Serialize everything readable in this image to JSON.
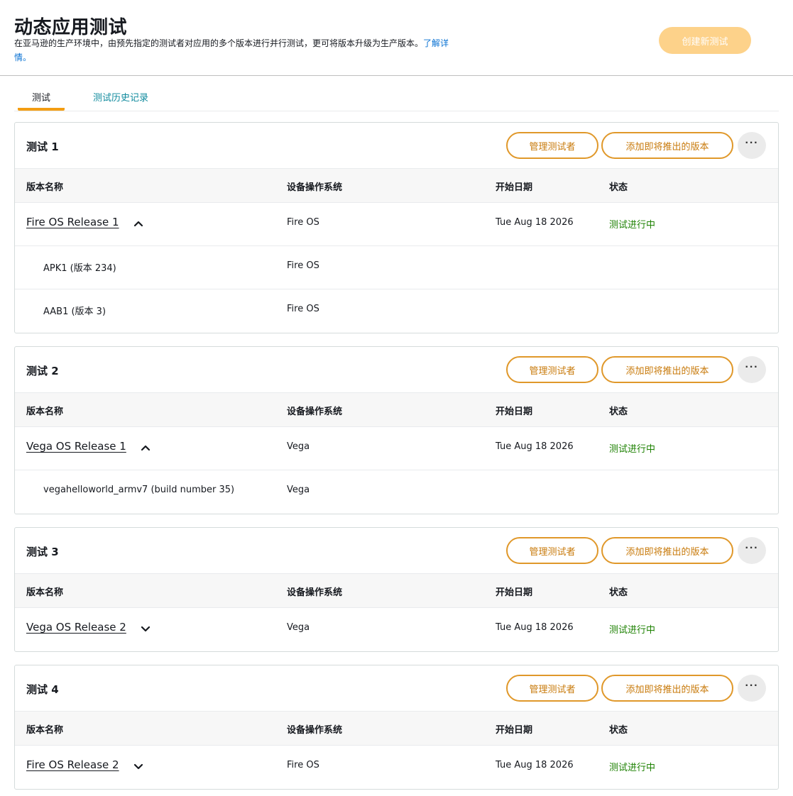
{
  "header": {
    "title": "动态应用测试",
    "description": "在亚马逊的生产环境中，由预先指定的测试者对应用的多个版本进行并行测试，更可将版本升级为生产版本。",
    "learn_more": "了解详情。",
    "create_button": "创建新测试"
  },
  "tabs": [
    {
      "label": "测试"
    },
    {
      "label": "测试历史记录"
    }
  ],
  "columns": {
    "name": "版本名称",
    "os": "设备操作系统",
    "start_date": "开始日期",
    "status": "状态"
  },
  "card_buttons": {
    "manage": "管理测试者",
    "add": "添加即将推出的版本",
    "more": "···"
  },
  "tests": [
    {
      "title": "测试 1",
      "release": {
        "name": "Fire OS Release 1",
        "os": "Fire OS",
        "start_date": "Tue Aug 18 2026",
        "status": "测试进行中",
        "expanded": true,
        "chevron_icon": "chevron-up-icon"
      },
      "builds": [
        {
          "name": "APK1 (版本 234)",
          "os": "Fire OS"
        },
        {
          "name": "AAB1 (版本 3)",
          "os": "Fire OS"
        }
      ]
    },
    {
      "title": "测试 2",
      "release": {
        "name": "Vega OS Release 1",
        "os": "Vega",
        "start_date": "Tue Aug 18 2026",
        "status": "测试进行中",
        "expanded": true,
        "chevron_icon": "chevron-up-icon"
      },
      "builds": [
        {
          "name": "vegahelloworld_armv7 (build number 35)",
          "os": "Vega"
        }
      ]
    },
    {
      "title": "测试 3",
      "release": {
        "name": "Vega OS Release 2",
        "os": "Vega",
        "start_date": "Tue Aug 18 2026",
        "status": "测试进行中",
        "expanded": false,
        "chevron_icon": "chevron-down-icon"
      },
      "builds": []
    },
    {
      "title": "测试 4",
      "release": {
        "name": "Fire OS Release 2",
        "os": "Fire OS",
        "start_date": "Tue Aug 18 2026",
        "status": "测试进行中",
        "expanded": false,
        "chevron_icon": "chevron-down-icon"
      },
      "builds": []
    }
  ],
  "colors": {
    "accent_orange": "#e0982a",
    "status_green": "#1d8102",
    "link_blue": "#0972d3",
    "tab_teal": "#0f8a9d"
  }
}
